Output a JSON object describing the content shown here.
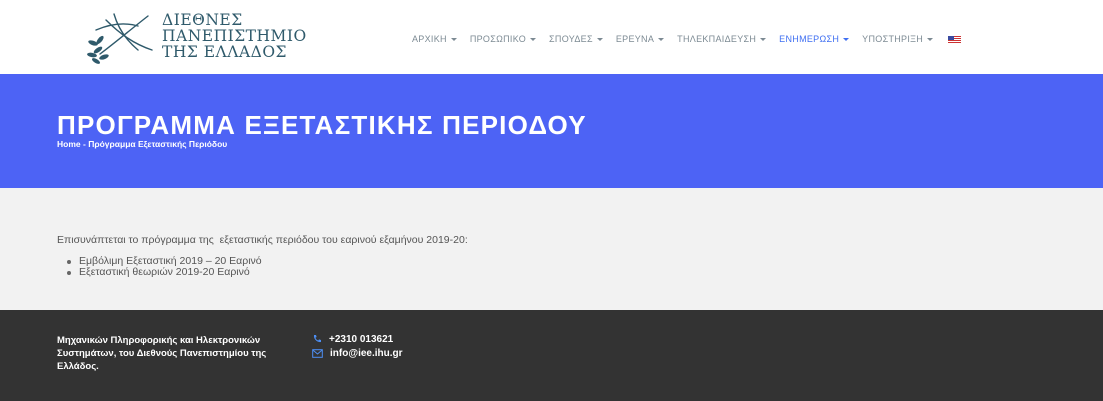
{
  "header": {
    "logo_lines": [
      "ΔΙΕΘΝΕΣ",
      "ΠΑΝΕΠΙΣΤΗΜΙΟ",
      "ΤΗΣ ΕΛΛΑΔΟΣ"
    ],
    "nav": [
      {
        "label": "ΑΡΧΙΚΗ",
        "active": false
      },
      {
        "label": "ΠΡΟΣΩΠΙΚΟ",
        "active": false
      },
      {
        "label": "ΣΠΟΥΔΕΣ",
        "active": false
      },
      {
        "label": "ΕΡΕΥΝΑ",
        "active": false
      },
      {
        "label": "ΤΗΛΕΚΠΑΙΔΕΥΣΗ",
        "active": false
      },
      {
        "label": "ΕΝΗΜΕΡΩΣΗ",
        "active": true
      },
      {
        "label": "ΥΠΟΣΤΗΡΙΞΗ",
        "active": false
      }
    ],
    "language_flag": "us-flag-icon"
  },
  "banner": {
    "title": "ΠΡΟΓΡΑΜΜΑ ΕΞΕΤΑΣΤΙΚΗΣ ΠΕΡΙΟΔΟΥ",
    "breadcrumb_home": "Home",
    "breadcrumb_sep": " - ",
    "breadcrumb_current": "Πρόγραμμα Εξεταστικής Περιόδου"
  },
  "content": {
    "intro": "Επισυνάπτεται το πρόγραμμα της  εξεταστικής περιόδου του εαρινού εξαμήνου 2019-20:",
    "links": [
      "Εμβόλιμη Εξεταστική 2019 – 20 Εαρινό",
      "Εξεταστική θεωριών 2019-20 Εαρινό"
    ]
  },
  "footer": {
    "about": "Μηχανικών Πληροφορικής και Ηλεκτρονικών Συστημάτων, του Διεθνούς Πανεπιστημίου της Ελλάδος.",
    "phone": "+2310 013621",
    "email": "info@iee.ihu.gr"
  },
  "colors": {
    "banner": "#4d63f5",
    "nav_active": "#3f6ff2",
    "footer": "#333333",
    "content_bg": "#f2f2f2"
  }
}
